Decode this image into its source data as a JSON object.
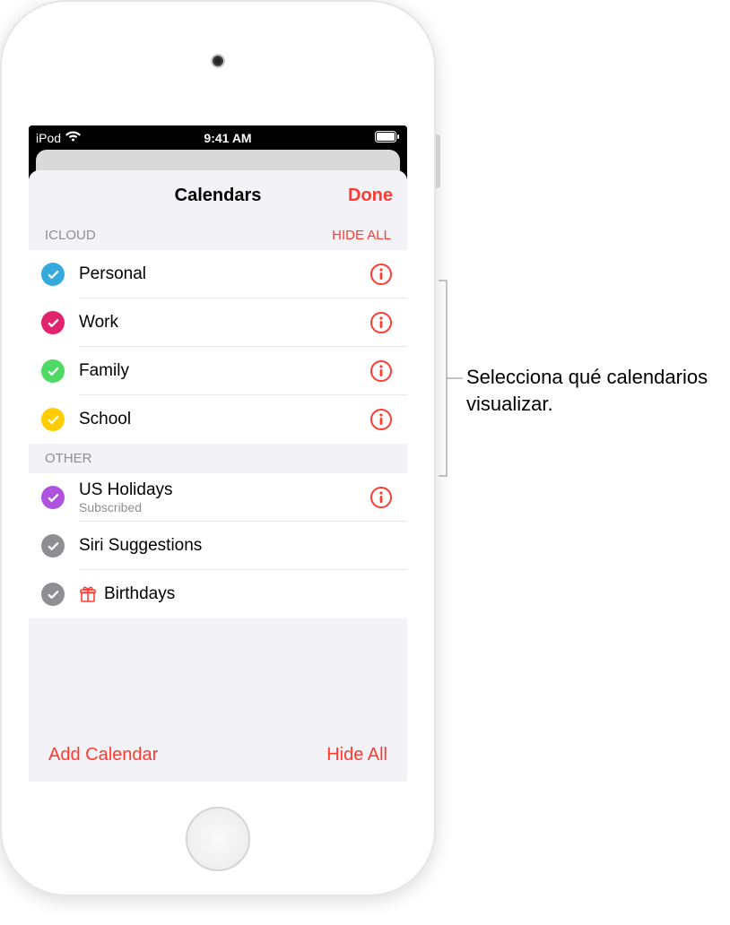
{
  "statusbar": {
    "carrier": "iPod",
    "time": "9:41 AM"
  },
  "sheet": {
    "title": "Calendars",
    "done_label": "Done"
  },
  "sections": {
    "icloud": {
      "label": "ICLOUD",
      "action": "HIDE ALL",
      "items": [
        {
          "label": "Personal",
          "color": "#34aadc"
        },
        {
          "label": "Work",
          "color": "#e2226d"
        },
        {
          "label": "Family",
          "color": "#4cd964"
        },
        {
          "label": "School",
          "color": "#ffcc00"
        }
      ]
    },
    "other": {
      "label": "OTHER",
      "items": [
        {
          "label": "US Holidays",
          "sublabel": "Subscribed",
          "color": "#af52de",
          "has_info": true
        },
        {
          "label": "Siri Suggestions",
          "color": "#8e8e93",
          "has_info": false
        },
        {
          "label": "Birthdays",
          "color": "#8e8e93",
          "has_info": false,
          "prefix_icon": "gift"
        }
      ]
    }
  },
  "footer": {
    "add_label": "Add Calendar",
    "hide_all_label": "Hide All"
  },
  "callout": {
    "text": "Selecciona qué calendarios visualizar."
  },
  "colors": {
    "accent": "#ff3b30"
  }
}
